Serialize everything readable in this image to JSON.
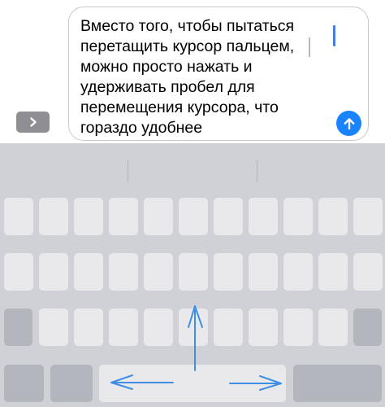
{
  "composer": {
    "message_text": "Вместо того, чтобы пытаться\nперетащить курсор пальцем,\nможно просто нажать и\nудерживать пробел для\nперемещения курсора, что\nгораздо удобнее"
  },
  "icons": {
    "expand": "chevron-right-icon",
    "send": "arrow-up-icon",
    "gesture_vertical": "arrow-up-icon",
    "gesture_left": "arrow-left-icon",
    "gesture_right": "arrow-right-icon"
  },
  "colors": {
    "send_button": "#1a84ff",
    "cursor": "#4a7ce6",
    "gesture_arrows": "#3f8fe4",
    "keyboard_background": "#d0d1d6",
    "key_light": "#e9e9ec",
    "key_dark": "#b4b6bd"
  },
  "keyboard": {
    "mode": "trackpad",
    "key_labels_visible": false
  }
}
